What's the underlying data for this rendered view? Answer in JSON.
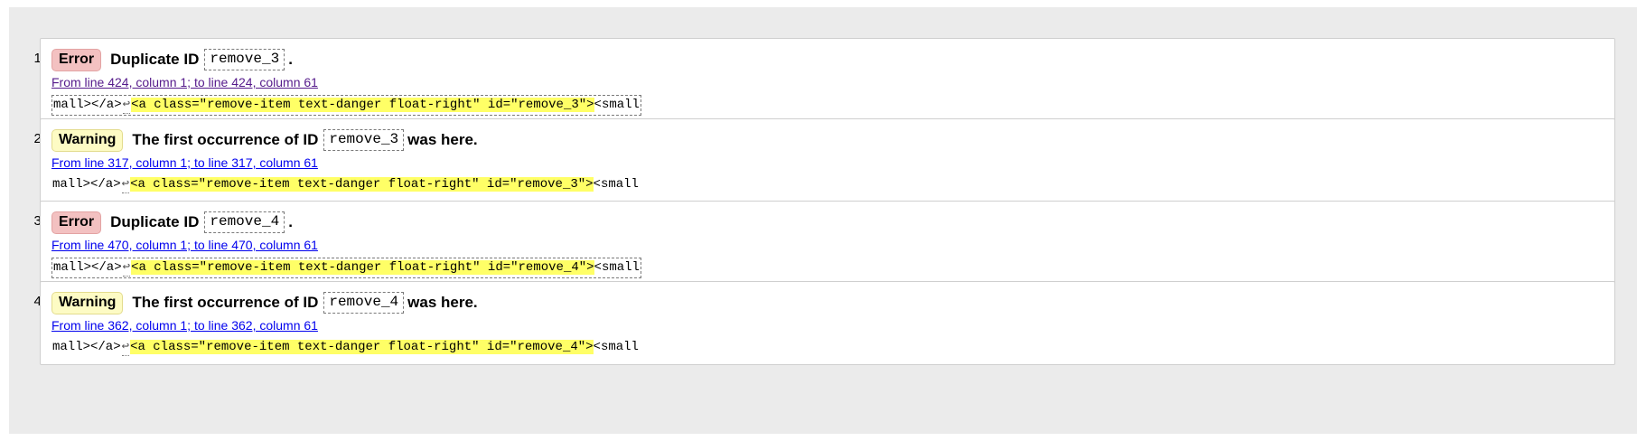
{
  "messages": [
    {
      "number": "1.",
      "type": "error",
      "badge": "Error",
      "prefix": "Duplicate ID",
      "id": "remove_3",
      "suffix": ".",
      "location": "From line 424, column 1; to line 424, column 61",
      "location_visited": true,
      "extract_before": "mall></a>",
      "extract_lf": "↩",
      "extract_highlight": "<a class=\"remove-item text-danger float-right\" id=\"remove_3\">",
      "extract_after": "<small",
      "extract_boxed": true
    },
    {
      "number": "2.",
      "type": "warning",
      "badge": "Warning",
      "prefix": "The first occurrence of ID",
      "id": "remove_3",
      "suffix": "was here.",
      "location": "From line 317, column 1; to line 317, column 61",
      "location_visited": false,
      "extract_before": "mall></a>",
      "extract_lf": "↩",
      "extract_highlight": "<a class=\"remove-item text-danger float-right\" id=\"remove_3\">",
      "extract_after": "<small",
      "extract_boxed": false
    },
    {
      "number": "3.",
      "type": "error",
      "badge": "Error",
      "prefix": "Duplicate ID",
      "id": "remove_4",
      "suffix": ".",
      "location": "From line 470, column 1; to line 470, column 61",
      "location_visited": false,
      "extract_before": "mall></a>",
      "extract_lf": "↩",
      "extract_highlight": "<a class=\"remove-item text-danger float-right\" id=\"remove_4\">",
      "extract_after": "<small",
      "extract_boxed": true
    },
    {
      "number": "4.",
      "type": "warning",
      "badge": "Warning",
      "prefix": "The first occurrence of ID",
      "id": "remove_4",
      "suffix": "was here.",
      "location": "From line 362, column 1; to line 362, column 61",
      "location_visited": false,
      "extract_before": "mall></a>",
      "extract_lf": "↩",
      "extract_highlight": "<a class=\"remove-item text-danger float-right\" id=\"remove_4\">",
      "extract_after": "<small",
      "extract_boxed": false
    }
  ]
}
